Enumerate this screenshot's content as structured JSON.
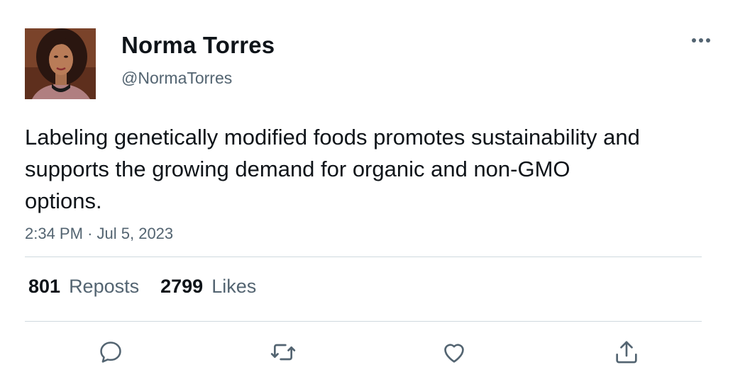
{
  "tweet": {
    "author": {
      "display_name": "Norma Torres",
      "handle": "@NormaTorres"
    },
    "text": "Labeling genetically modified foods promotes sustainability and supports the growing demand for organic and non-GMO options.",
    "time": "2:34 PM",
    "separator": "·",
    "date": "Jul 5, 2023",
    "stats": {
      "reposts_count": "801",
      "reposts_label": "Reposts",
      "likes_count": "2799",
      "likes_label": "Likes"
    }
  },
  "icons": {
    "more": "more-icon",
    "reply": "reply-icon",
    "repost": "repost-icon",
    "like": "heart-icon",
    "share": "share-icon"
  },
  "colors": {
    "text": "#0f1419",
    "secondary": "#536471",
    "divider": "#cfd9de"
  }
}
